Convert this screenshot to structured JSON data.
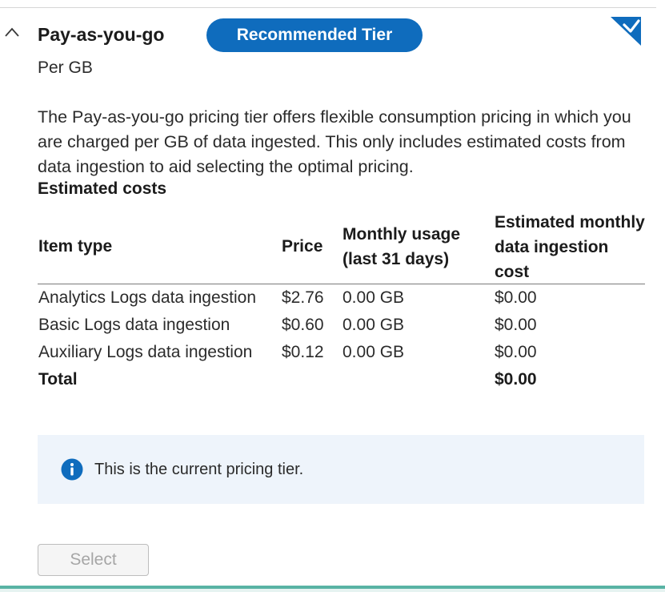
{
  "tier": {
    "name": "Pay-as-you-go",
    "badge": "Recommended Tier",
    "unit": "Per GB",
    "description": "The Pay-as-you-go pricing tier offers flexible consumption pricing in which you are charged per GB of data ingested. This only includes estimated costs from data ingestion to aid selecting the optimal pricing.",
    "selected": true
  },
  "costs": {
    "heading": "Estimated costs",
    "columns": {
      "item": "Item type",
      "price": "Price",
      "usage": "Monthly usage (last 31 days)",
      "cost": "Estimated monthly data ingestion cost"
    },
    "rows": [
      {
        "item": "Analytics Logs data ingestion",
        "price": "$2.76",
        "usage": "0.00 GB",
        "cost": "$0.00"
      },
      {
        "item": "Basic Logs data ingestion",
        "price": "$0.60",
        "usage": "0.00 GB",
        "cost": "$0.00"
      },
      {
        "item": "Auxiliary Logs data ingestion",
        "price": "$0.12",
        "usage": "0.00 GB",
        "cost": "$0.00"
      }
    ],
    "total": {
      "label": "Total",
      "cost": "$0.00"
    }
  },
  "info": {
    "message": "This is the current pricing tier.",
    "icon": "info-icon"
  },
  "actions": {
    "select_label": "Select",
    "select_disabled": true
  },
  "colors": {
    "accent": "#0f6cbd",
    "info_background": "#eef4fb",
    "bottom_bar": "#59b3a4"
  }
}
